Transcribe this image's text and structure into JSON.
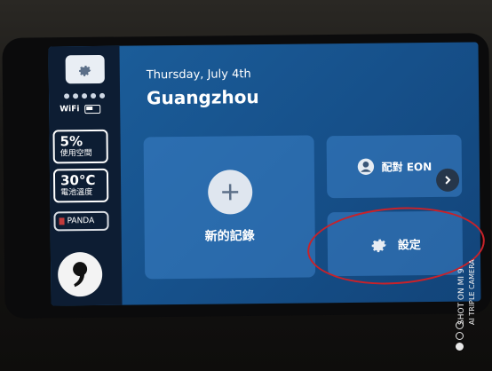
{
  "colors": {
    "screen": "#1c5f9c",
    "sidebar": "#0d1d33",
    "card": "#3c82c8",
    "annotation": "#c8222a"
  },
  "sidebar": {
    "settings_icon": "gear-icon",
    "wifi_label": "WiFi",
    "stats": [
      {
        "value": "5%",
        "label": "使用空間"
      },
      {
        "value": "30°C",
        "label": "電池溫度"
      }
    ],
    "panda_label": "PANDA",
    "logo_icon": "comma-logo"
  },
  "header": {
    "date": "Thursday, July 4th",
    "city": "Guangzhou"
  },
  "actions": {
    "new_record": {
      "label": "新的記錄",
      "icon": "plus-icon"
    },
    "pair": {
      "label": "配對 EON",
      "icon": "user-icon"
    },
    "settings": {
      "label": "設定",
      "icon": "gear-icon"
    }
  },
  "watermark": {
    "line1": "SHOT ON MI 9",
    "line2": "AI TRIPLE CAMERA"
  }
}
